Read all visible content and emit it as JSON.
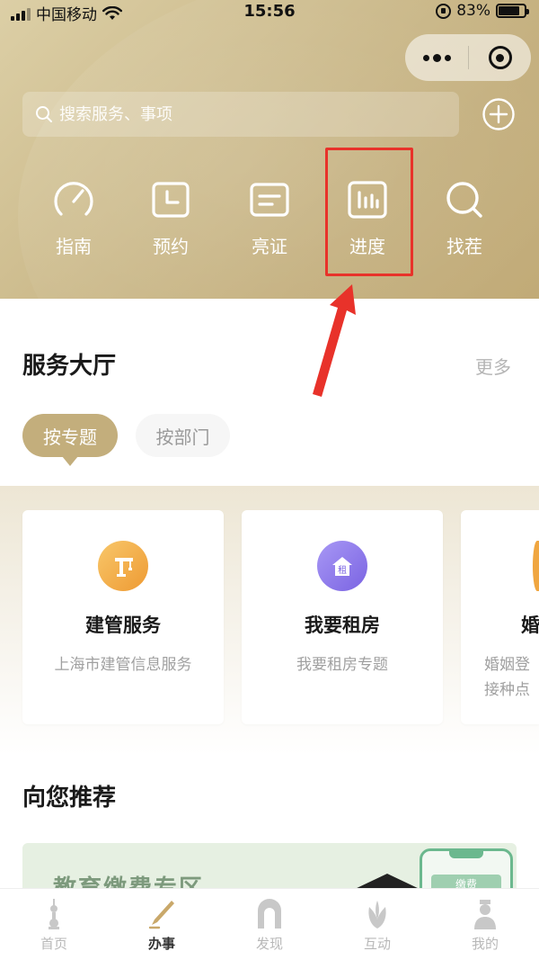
{
  "status_bar": {
    "carrier": "中国移动",
    "time": "15:56",
    "battery_percent": "83%",
    "battery_level": 0.83
  },
  "search": {
    "placeholder": "搜索服务、事项"
  },
  "quick_actions": [
    {
      "label": "指南",
      "icon": "gauge-icon"
    },
    {
      "label": "预约",
      "icon": "clock-icon"
    },
    {
      "label": "亮证",
      "icon": "card-icon"
    },
    {
      "label": "进度",
      "icon": "bar-chart-icon"
    },
    {
      "label": "找茬",
      "icon": "search-icon"
    }
  ],
  "highlighted_action": "进度",
  "service_hall": {
    "title": "服务大厅",
    "more": "更多",
    "tabs": [
      {
        "label": "按专题",
        "active": true
      },
      {
        "label": "按部门",
        "active": false
      }
    ],
    "cards": [
      {
        "title": "建管服务",
        "desc": "上海市建管信息服务",
        "icon": "crane-icon",
        "color": "#f0a640"
      },
      {
        "title": "我要租房",
        "desc": "我要租房专题",
        "icon": "house-rent-icon",
        "icon_text": "租",
        "color": "#8a76e8"
      },
      {
        "title": "婚",
        "desc_lines": [
          "婚姻登",
          "接种点"
        ],
        "icon": "wedding-icon",
        "color": "#f0a640"
      }
    ]
  },
  "recommend": {
    "title": "向您推荐",
    "banner_title": "教育缴费专区",
    "banner_badge": "缴费"
  },
  "tabbar": [
    {
      "label": "首页",
      "icon": "tower-icon",
      "active": false
    },
    {
      "label": "办事",
      "icon": "pen-icon",
      "active": true
    },
    {
      "label": "发现",
      "icon": "arch-icon",
      "active": false
    },
    {
      "label": "互动",
      "icon": "magnolia-icon",
      "active": false
    },
    {
      "label": "我的",
      "icon": "person-icon",
      "active": false
    }
  ],
  "colors": {
    "header_gold": "#c3ae7c",
    "highlight_red": "#e8322a",
    "text_dark": "#1a1a1a",
    "text_muted": "#a0a0a0"
  }
}
